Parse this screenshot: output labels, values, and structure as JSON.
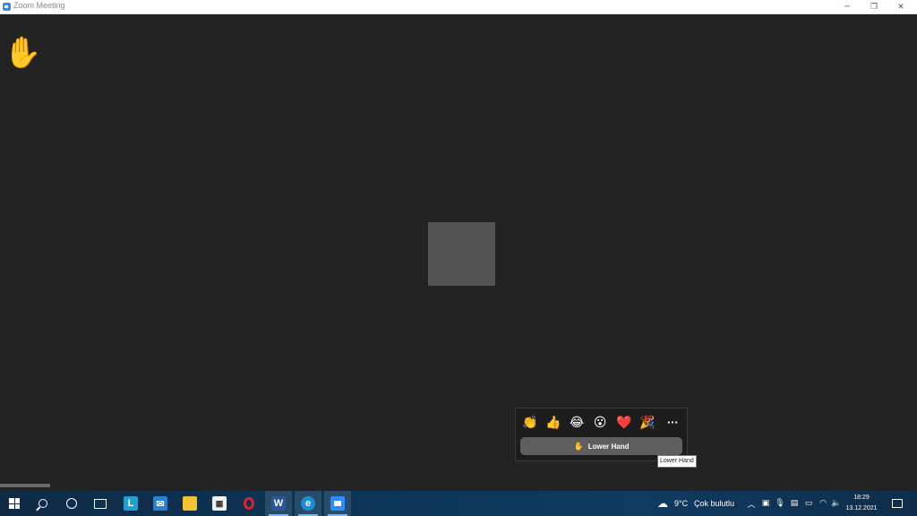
{
  "window": {
    "title": "Zoom Meeting"
  },
  "meeting": {
    "raised_hand_icon": "✋"
  },
  "reactions": {
    "emojis": [
      {
        "name": "clap",
        "glyph": "👏"
      },
      {
        "name": "thumbs-up",
        "glyph": "👍"
      },
      {
        "name": "joy",
        "glyph": "😂"
      },
      {
        "name": "surprised",
        "glyph": "😮"
      },
      {
        "name": "heart",
        "glyph": "❤️"
      },
      {
        "name": "party",
        "glyph": "🎉"
      }
    ],
    "more": "···",
    "lower_hand_icon": "✋",
    "lower_hand_label": "Lower Hand",
    "tooltip": "Lower Hand"
  },
  "taskbar": {
    "weather_temp": "9°C",
    "weather_text": "Çok bulutlu",
    "time": "18:29",
    "date": "13.12.2021",
    "accent": "#0c3557"
  }
}
